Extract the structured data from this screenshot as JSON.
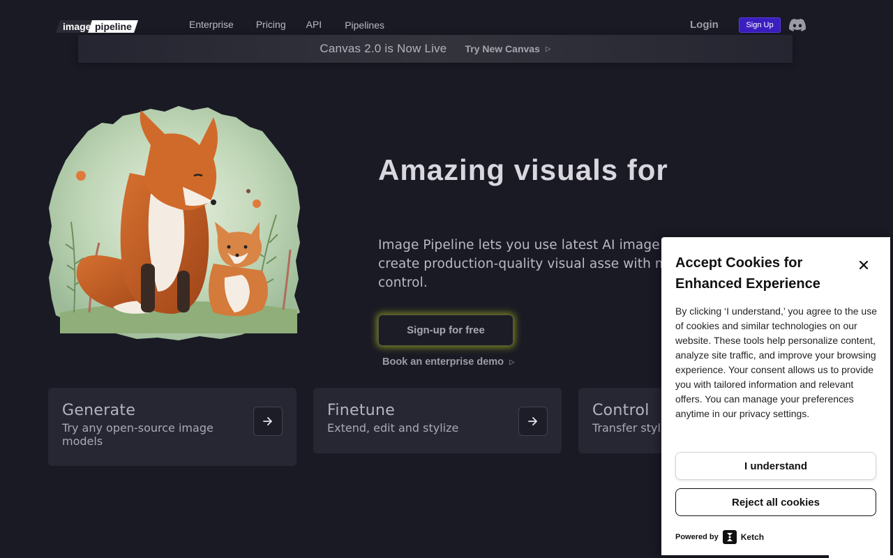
{
  "nav": {
    "logo_text_left": "image",
    "logo_text_right": "pipeline",
    "links": [
      "Enterprise",
      "Pricing",
      "API",
      "Pipelines"
    ],
    "login_label": "Login",
    "signup_label": "Sign Up",
    "discord_icon": "discord-icon",
    "signup_color": "#3b1ec0"
  },
  "announcement": {
    "text": "Canvas 2.0 is Now Live",
    "link_label": "Try New Canvas"
  },
  "hero": {
    "title": "Amazing visuals for",
    "description": "Image Pipeline lets you use latest AI image te stack to create production-quality visual asse with maximum control.",
    "cta_label": "Sign-up for free",
    "cta_glow_color": "#d6ec18",
    "demo_label": "Book an enterprise demo"
  },
  "cards": [
    {
      "title": "Generate",
      "subtitle": "Try any open-source image models"
    },
    {
      "title": "Finetune",
      "subtitle": "Extend, edit and stylize"
    },
    {
      "title": "Control",
      "subtitle": "Transfer styl"
    }
  ],
  "cookie": {
    "title": "Accept Cookies for Enhanced Experience",
    "body": "By clicking ‘I understand,’ you agree to the use of cookies and similar technologies on our website. These tools help personalize content, analyze site traffic, and improve your browsing experience. Your consent allows us to provide you with tailored information and relevant offers. You can manage your preferences anytime in our privacy settings.",
    "accept_label": "I understand",
    "reject_label": "Reject all cookies",
    "powered_by": "Powered by",
    "vendor": "Ketch"
  }
}
